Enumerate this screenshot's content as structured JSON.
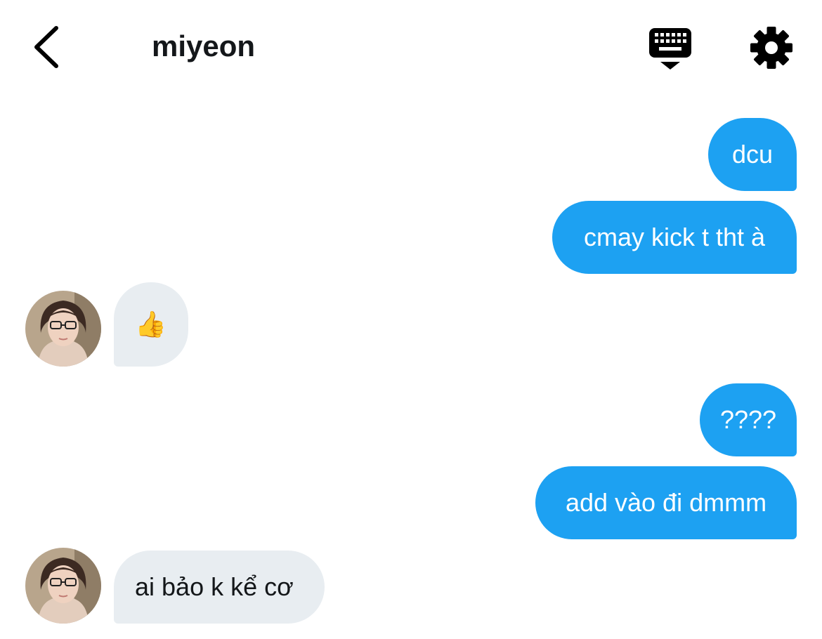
{
  "header": {
    "title": "miyeon",
    "back_icon": "chevron-left-icon",
    "keyboard_icon": "keyboard-icon",
    "settings_icon": "gear-icon"
  },
  "colors": {
    "outgoing_bubble": "#1da1f2",
    "incoming_bubble": "#e8edf1",
    "title_text": "#14171a"
  },
  "messages": [
    {
      "direction": "outgoing",
      "text": "dcu"
    },
    {
      "direction": "outgoing",
      "text": "cmay kick t tht à"
    },
    {
      "direction": "incoming",
      "text": "👍"
    },
    {
      "direction": "outgoing",
      "text": "????"
    },
    {
      "direction": "outgoing",
      "text": "add vào đi dmmm"
    },
    {
      "direction": "incoming",
      "text": "ai bảo k kể cơ"
    }
  ]
}
